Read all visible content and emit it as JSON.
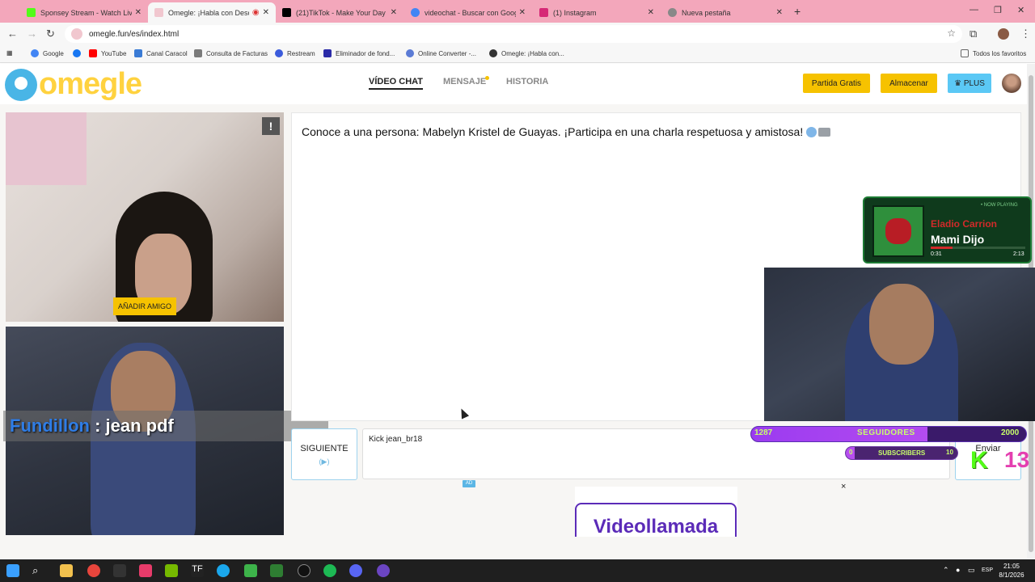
{
  "browser": {
    "tabs": [
      {
        "title": "Sponsey Stream - Watch Live o",
        "icon_color": "#53fc18"
      },
      {
        "title": "Omegle: ¡Habla con Descon",
        "icon_color": "#f1c7cf",
        "active": true
      },
      {
        "title": "(21)TikTok - Make Your Day",
        "icon_color": "#000000"
      },
      {
        "title": "videochat - Buscar con Google",
        "icon_color": "#4285f4"
      },
      {
        "title": "(1) Instagram",
        "icon_color": "#d62976"
      },
      {
        "title": "Nueva pestaña",
        "icon_color": "#888888"
      }
    ],
    "url": "omegle.fun/es/index.html",
    "bookmarks": [
      {
        "label": "Google",
        "icon_color": "#4285f4"
      },
      {
        "label": "",
        "icon_color": "#1877f2"
      },
      {
        "label": "YouTube",
        "icon_color": "#ff0000"
      },
      {
        "label": "Canal Caracol",
        "icon_color": "#3a7bd5"
      },
      {
        "label": "Consulta de Facturas",
        "icon_color": "#7a7a7a"
      },
      {
        "label": "Restream",
        "icon_color": "#3b5bdb"
      },
      {
        "label": "Eliminador de fond...",
        "icon_color": "#2b2ba8"
      },
      {
        "label": "Online Converter -...",
        "icon_color": "#5b7bd5"
      },
      {
        "label": "Omegle: ¡Habla con...",
        "icon_color": "#333333"
      }
    ],
    "all_favorites": "Todos los favoritos"
  },
  "site": {
    "logo_text": "omegle",
    "nav": {
      "video_chat": "VÍDEO CHAT",
      "message": "MENSAJE",
      "history": "HISTORIA"
    },
    "buttons": {
      "free_game": "Partida Gratis",
      "store": "Almacenar",
      "plus": "PLUS"
    },
    "add_friend": "AÑADIR AMIGO",
    "report": "!",
    "chat_intro": "Conoce a una persona: Mabelyn Kristel de Guayas. ¡Participa en una charla respetuosa y amistosa!",
    "next_button": "SIGUIENTE",
    "next_icon": "(▶)",
    "message_value": "Kick jean_br18",
    "send_button": "Enviar",
    "ad_badge": "AD",
    "ad_close": "×",
    "ad_text": "Videollamada"
  },
  "stream_overlay": {
    "name_label": "Fundillon",
    "name_suffix": " : jean pdf",
    "now_playing": {
      "tag": "• NOW PLAYING",
      "artist": "Eladio Carrion",
      "title": "Mami Dijo",
      "current": "0:31",
      "duration": "2:13",
      "progress": 0.23
    },
    "followers_goal": {
      "current": "1287",
      "label": "SEGUIDORES",
      "target": "2000",
      "progress": 0.64
    },
    "subs_goal": {
      "current": "0",
      "label": "SUBSCRIBERS",
      "target": "10",
      "progress": 0.08
    },
    "kick_count": "13"
  },
  "taskbar": {
    "lang": "ESP",
    "time": "21:05",
    "date": "8/1/2026"
  },
  "colors": {
    "accent": "#f6c200",
    "plus": "#5bc8f5",
    "logo_blue": "#49b5e6",
    "logo_yellow": "#ffd23f"
  }
}
